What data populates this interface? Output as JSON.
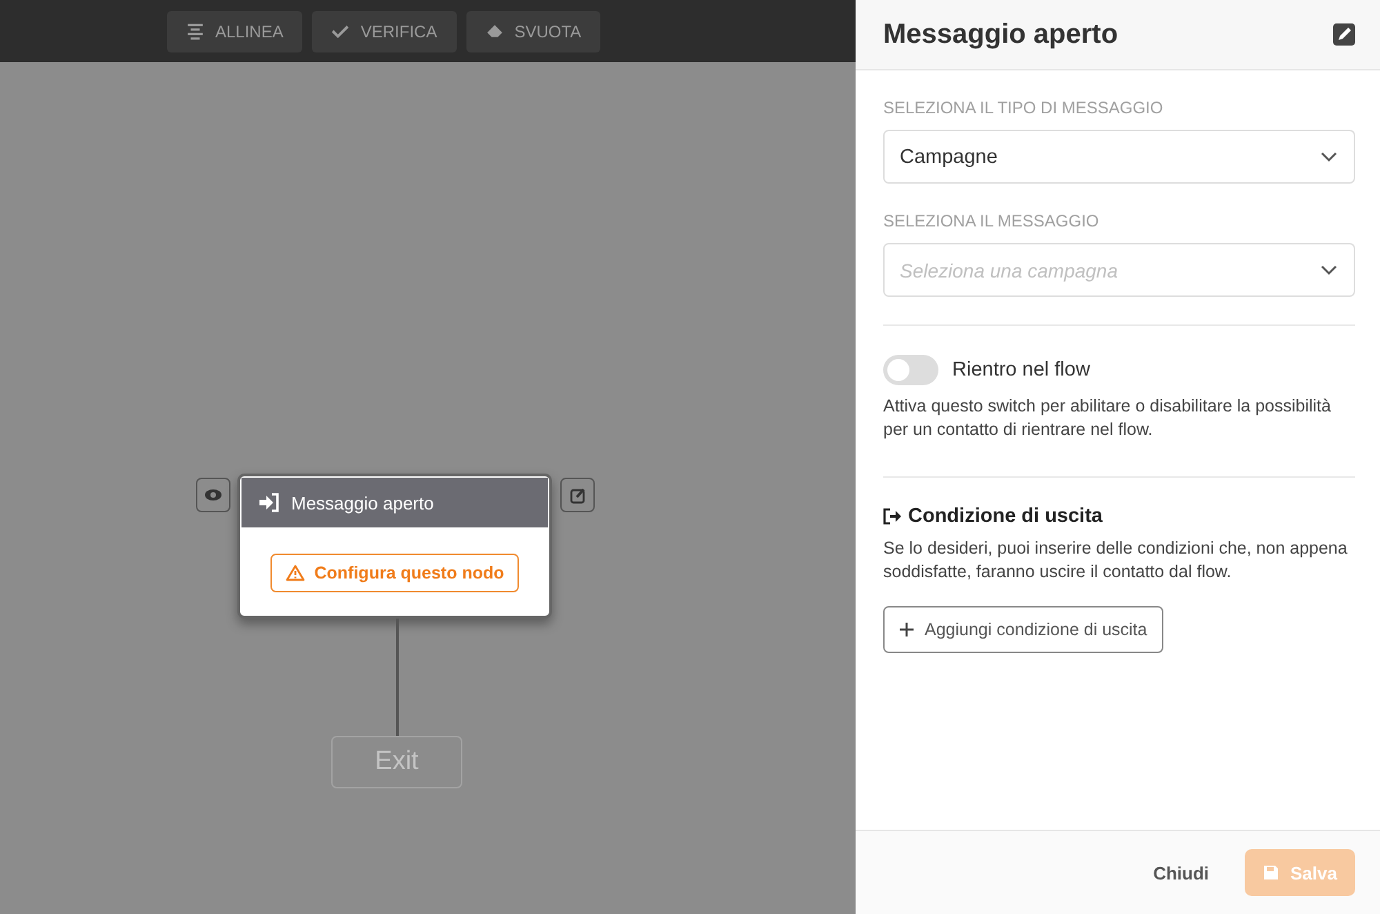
{
  "toolbar": [
    {
      "kind": "align",
      "label": "ALLINEA"
    },
    {
      "kind": "check",
      "label": "VERIFICA"
    },
    {
      "kind": "erase",
      "label": "SVUOTA"
    }
  ],
  "node": {
    "title": "Messaggio aperto",
    "warning": "Configura questo nodo"
  },
  "exit_node": {
    "label": "Exit"
  },
  "panel": {
    "title": "Messaggio aperto",
    "fields": [
      {
        "label": "SELEZIONA IL TIPO DI MESSAGGIO",
        "value": "Campagne"
      },
      {
        "label": "SELEZIONA IL MESSAGGIO",
        "placeholder": "Seleziona una campagna"
      }
    ],
    "toggle": {
      "label": "Rientro nel flow",
      "on": false,
      "description": "Attiva questo switch per abilitare o disabilitare la possibilità per un contatto di rientrare nel flow."
    },
    "exit_condition": {
      "title": "Condizione di uscita",
      "description": "Se lo desideri, puoi inserire delle condizioni che, non appena soddisfatte, faranno uscire il contatto dal flow.",
      "button": "Aggiungi condizione di uscita"
    },
    "footer": {
      "close": "Chiudi",
      "save": "Salva",
      "save_disabled": true
    }
  }
}
